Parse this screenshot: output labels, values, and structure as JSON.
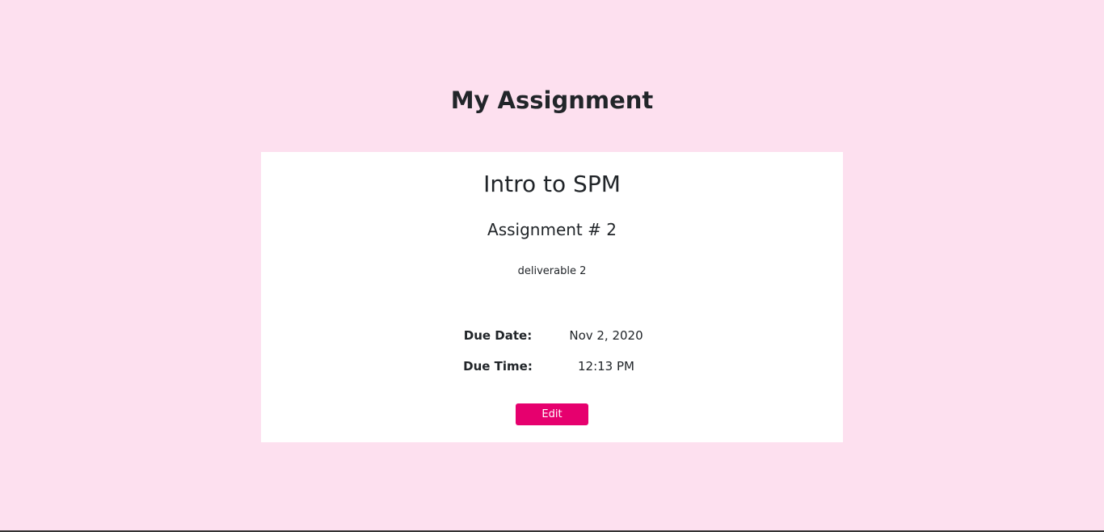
{
  "page": {
    "title": "My Assignment",
    "background_color": "#fde0ef"
  },
  "assignment": {
    "course": "Intro to SPM",
    "name": "Assignment # 2",
    "description": "deliverable 2",
    "due_date_label": "Due Date:",
    "due_date": "Nov 2, 2020",
    "due_time_label": "Due Time:",
    "due_time": "12:13 PM"
  },
  "actions": {
    "edit_label": "Edit",
    "edit_color": "#e6006e"
  }
}
